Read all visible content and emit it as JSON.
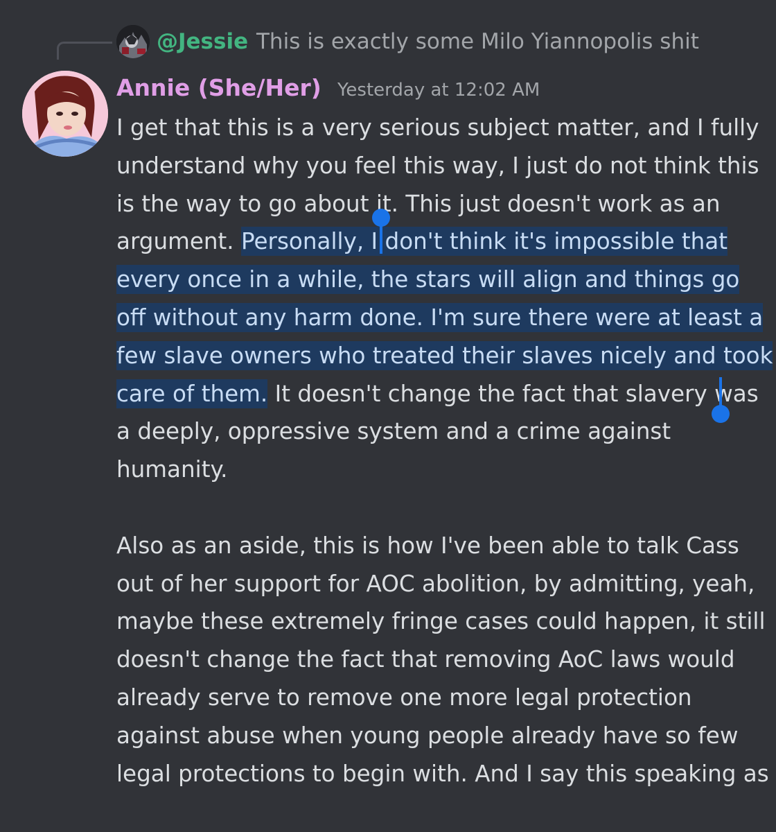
{
  "reply": {
    "username": "@Jessie",
    "text": "This is exactly some Milo Yiannopolis shit"
  },
  "message": {
    "author": "Annie (She/Her)",
    "timestamp": "Yesterday at 12:02 AM",
    "p1_before": "I get that this is a very serious subject matter, and I fully understand why you feel this way, I just do not think this is the way to go about it. This just doesn't work as an argument.",
    "p1_selected": "Personally, I don't think it's impossible that every once in a while, the stars will align and things go off without any harm done. I'm sure there were at least a few slave owners who treated their slaves nicely and took care of them.",
    "p1_after": "It doesn't change the fact that slavery was a deeply, oppressive system and a crime against humanity.",
    "p2": "Also as an aside, this is how I've been able to talk Cass out of her support for AOC abolition, by admitting, yeah, maybe these extremely fringe cases could happen, it still doesn't change the fact that removing AoC laws would already serve to remove one more legal protection against abuse when young people already have so few legal protections to begin with. And I say this speaking as"
  },
  "colors": {
    "background": "#313338",
    "reply_username": "#43b581",
    "author_name": "#e09ee6",
    "selection_highlight": "#1e3a5f",
    "selection_handle": "#1a73e8"
  }
}
